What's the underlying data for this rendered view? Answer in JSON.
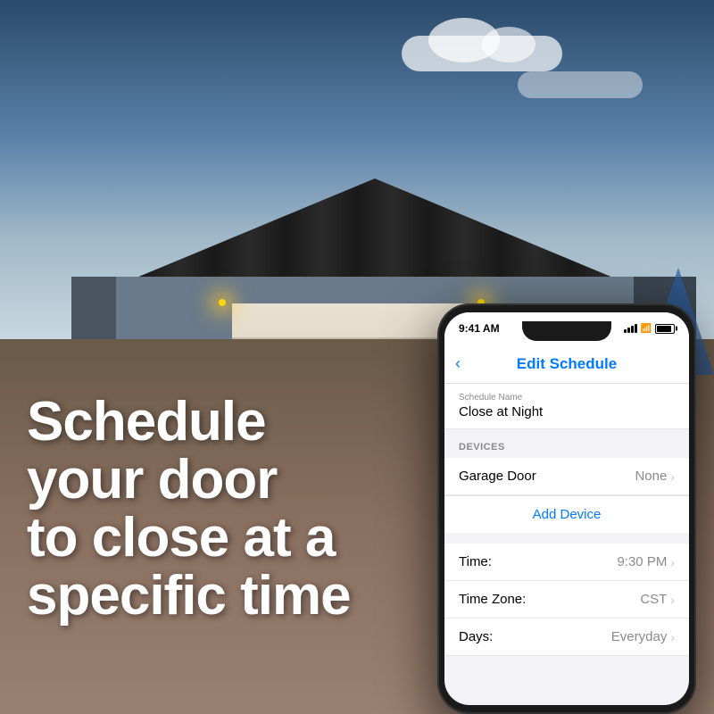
{
  "background": {
    "alt": "House with garage door at night"
  },
  "headline": {
    "line1": "Schedule",
    "line2": "your door",
    "line3": "to close at a",
    "line4": "specific time",
    "full_text": "Schedule your door to close at a specific time"
  },
  "phone": {
    "status_bar": {
      "time": "9:41 AM"
    },
    "nav": {
      "back_label": "‹",
      "title": "Edit Schedule"
    },
    "form": {
      "schedule_name_label": "Schedule Name",
      "schedule_name_value": "Close at Night",
      "devices_section": "DEVICES",
      "device_name": "Garage Door",
      "device_value": "None",
      "add_device_label": "Add Device",
      "time_label": "Time:",
      "time_value": "9:30 PM",
      "timezone_label": "Time Zone:",
      "timezone_value": "CST",
      "days_label": "Days:",
      "days_value": "Everyday"
    }
  }
}
